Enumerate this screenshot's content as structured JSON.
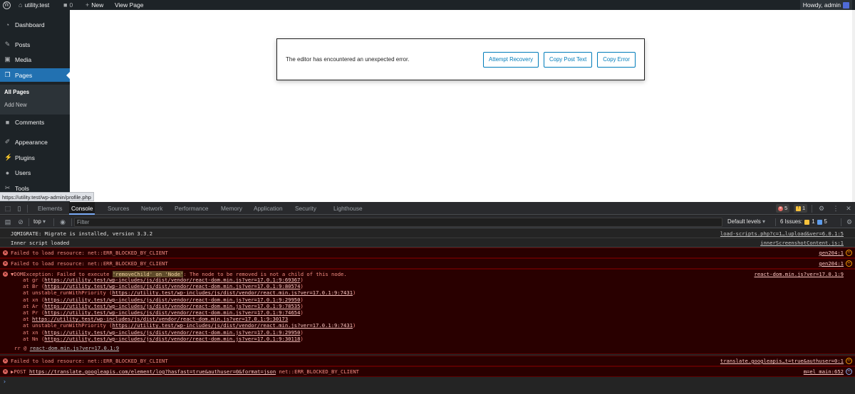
{
  "adminbar": {
    "site_name": "utility.test",
    "comments_count": "0",
    "new_label": "New",
    "view_page_label": "View Page",
    "howdy_label": "Howdy, admin"
  },
  "sidebar": {
    "items": [
      {
        "label": "Dashboard",
        "icon": "dashboard-icon"
      },
      {
        "label": "Posts",
        "icon": "pin-icon"
      },
      {
        "label": "Media",
        "icon": "media-icon"
      },
      {
        "label": "Pages",
        "icon": "pages-icon"
      },
      {
        "label": "Comments",
        "icon": "comments-icon"
      },
      {
        "label": "Appearance",
        "icon": "brush-icon"
      },
      {
        "label": "Plugins",
        "icon": "plugin-icon"
      },
      {
        "label": "Users",
        "icon": "users-icon"
      },
      {
        "label": "Tools",
        "icon": "wrench-icon"
      }
    ],
    "submenu": [
      "All Pages",
      "Add New"
    ],
    "status_url": "https://utility.test/wp-admin/profile.php"
  },
  "editor": {
    "error_message": "The editor has encountered an unexpected error.",
    "attempt_recovery": "Attempt Recovery",
    "copy_post_text": "Copy Post Text",
    "copy_error": "Copy Error"
  },
  "devtools": {
    "tabs": [
      "Elements",
      "Console",
      "Sources",
      "Network",
      "Performance",
      "Memory",
      "Application",
      "Security",
      "Lighthouse"
    ],
    "selected_tab": "Console",
    "error_count": "5",
    "warning_count": "1",
    "context": "top",
    "filter_placeholder": "Filter",
    "levels": "Default levels",
    "issues_label": "6 Issues:",
    "issues_warn": "1",
    "issues_info": "5",
    "colors": {
      "accent": "#7cacf8",
      "error": "#e46962",
      "wp_blue": "#2271b1"
    }
  },
  "console": {
    "jqmigrate": {
      "text": "JQMIGRATE: Migrate is installed, version 3.3.2",
      "src": "load-scripts.php?c=1…lupload&ver=6.0.1:5"
    },
    "inner": {
      "text": "Inner script loaded",
      "src": "innerScreenshotContent.js:1"
    },
    "err1": {
      "text": "Failed to load resource: net::ERR_BLOCKED_BY_CLIENT",
      "src": "gen204:1"
    },
    "err2": {
      "text": "Failed to load resource: net::ERR_BLOCKED_BY_CLIENT",
      "src": "gen204:1"
    },
    "dom": {
      "prefix": "▼DOMException: Failed to execute ",
      "remove_child": "'removeChild' on 'Node'",
      "suffix": ": The node to be removed is not a child of this node.",
      "src": "react-dom.min.js?ver=17.0.1:9",
      "trace": [
        {
          "fn": "at gr (",
          "url": "https://utility.test/wp-includes/js/dist/vendor/react-dom.min.js?ver=17.0.1:9:69367",
          "end": ")"
        },
        {
          "fn": "at Br (",
          "url": "https://utility.test/wp-includes/js/dist/vendor/react-dom.min.js?ver=17.0.1:9:80574",
          "end": ")"
        },
        {
          "fn": "at unstable_runWithPriority (",
          "url": "https://utility.test/wp-includes/js/dist/vendor/react.min.js?ver=17.0.1:9:7431",
          "end": ")"
        },
        {
          "fn": "at xn (",
          "url": "https://utility.test/wp-includes/js/dist/vendor/react-dom.min.js?ver=17.0.1:9:29950",
          "end": ")"
        },
        {
          "fn": "at Ar (",
          "url": "https://utility.test/wp-includes/js/dist/vendor/react-dom.min.js?ver=17.0.1:9:78535",
          "end": ")"
        },
        {
          "fn": "at Pr (",
          "url": "https://utility.test/wp-includes/js/dist/vendor/react-dom.min.js?ver=17.0.1:9:74654",
          "end": ")"
        },
        {
          "fn": "at ",
          "url": "https://utility.test/wp-includes/js/dist/vendor/react-dom.min.js?ver=17.0.1:9:30173",
          "end": ""
        },
        {
          "fn": "at unstable_runWithPriority (",
          "url": "https://utility.test/wp-includes/js/dist/vendor/react.min.js?ver=17.0.1:9:7431",
          "end": ")"
        },
        {
          "fn": "at xn (",
          "url": "https://utility.test/wp-includes/js/dist/vendor/react-dom.min.js?ver=17.0.1:9:29950",
          "end": ")"
        },
        {
          "fn": "at Nn (",
          "url": "https://utility.test/wp-includes/js/dist/vendor/react-dom.min.js?ver=17.0.1:9:30118",
          "end": ")"
        }
      ],
      "rr_prefix": "rr @ ",
      "rr_link": "react-dom.min.js?ver=17.0.1:9"
    },
    "err3": {
      "text": "Failed to load resource: net::ERR_BLOCKED_BY_CLIENT",
      "src": "translate.googleapis…t=true&authuser=0:1"
    },
    "post": {
      "prefix": "▶POST ",
      "url": "https://translate.googleapis.com/element/log?hasfast=true&authuser=0&format=json",
      "suffix": " net::ERR_BLOCKED_BY_CLIENT",
      "src": "m=el_main:652"
    }
  }
}
